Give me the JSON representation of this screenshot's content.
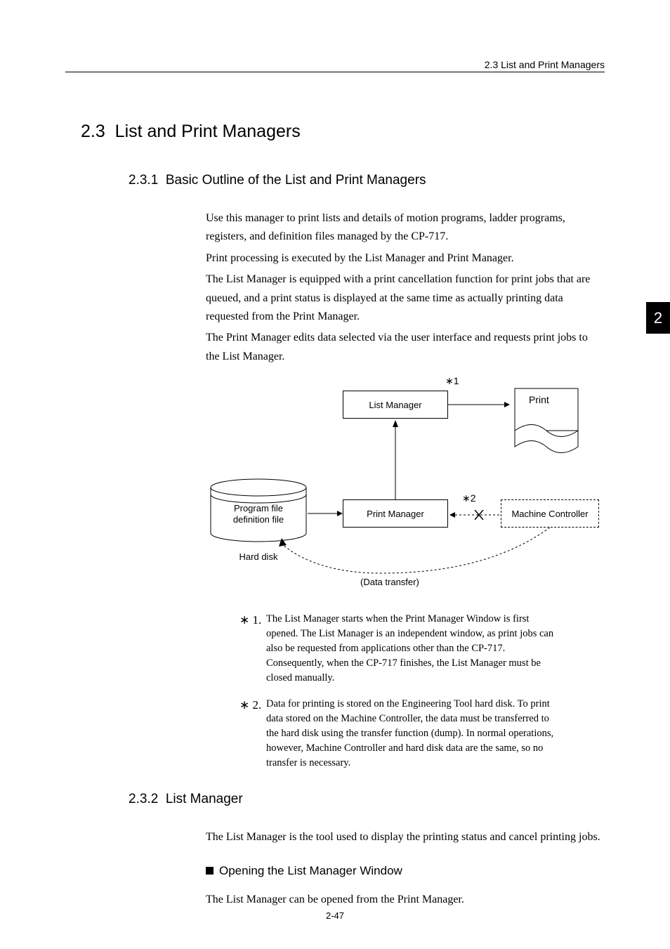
{
  "header": {
    "breadcrumb": "2.3  List and Print Managers"
  },
  "page_tab": "2",
  "section": {
    "number": "2.3",
    "title": "List and Print Managers"
  },
  "subsection1": {
    "number": "2.3.1",
    "title": "Basic Outline of the List and Print Managers",
    "para1": "Use this manager to print lists and details of motion programs, ladder programs, registers, and definition files managed by the CP-717.",
    "para2": "Print processing is executed by the List Manager and Print Manager.",
    "para3": "The List Manager is equipped with a print cancellation function for print jobs that are queued, and a print status is displayed at the same time as actually printing data requested from the Print Manager.",
    "para4": "The Print Manager edits data selected via the user interface and requests print jobs to the List Manager."
  },
  "diagram": {
    "list_manager": "List Manager",
    "print": "Print",
    "print_manager": "Print Manager",
    "machine_controller": "Machine Controller",
    "program_file_line1": "Program file",
    "program_file_line2": "definition file",
    "hard_disk": "Hard disk",
    "data_transfer": "(Data transfer)",
    "ref1": "∗1",
    "ref2": "∗2"
  },
  "notes": {
    "n1_marker": "∗ 1.",
    "n1_text": "The List Manager starts when the Print Manager Window is first opened. The List Manager is an independent window, as print jobs can also be requested from applications other than the CP-717. Consequently, when the CP-717 finishes, the List Manager must be closed manually.",
    "n2_marker": "∗ 2.",
    "n2_text": "Data for printing is stored on the Engineering Tool hard disk. To print data stored on the Machine Controller, the data must be transferred to the hard disk using the transfer function (dump). In normal operations, however, Machine Controller and hard disk data are the same, so no transfer is necessary."
  },
  "subsection2": {
    "number": "2.3.2",
    "title": "List Manager",
    "para1": "The List Manager is the tool used to display the printing status and cancel printing jobs.",
    "heading": "Opening the List Manager Window",
    "para2": "The List Manager can be opened from the Print Manager."
  },
  "footer": "2-47"
}
